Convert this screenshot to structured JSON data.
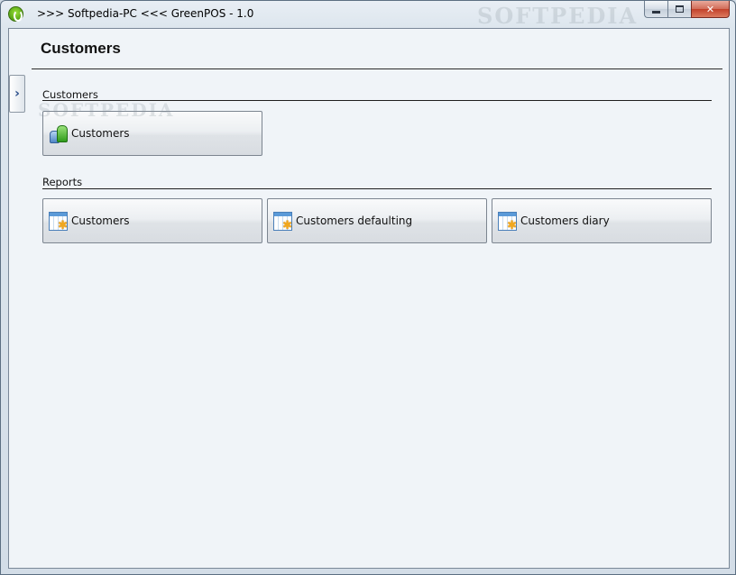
{
  "window": {
    "title": ">>> Softpedia-PC <<< GreenPOS - 1.0",
    "watermark": "SOFTPEDIA"
  },
  "page": {
    "title": "Customers",
    "side_toggle": "›"
  },
  "groups": [
    {
      "label": "Customers",
      "tiles": [
        {
          "label": "Customers",
          "icon": "users-icon"
        }
      ]
    },
    {
      "label": "Reports",
      "tiles": [
        {
          "label": "Customers",
          "icon": "report-icon"
        },
        {
          "label": "Customers defaulting",
          "icon": "report-icon"
        },
        {
          "label": "Customers diary",
          "icon": "report-icon"
        }
      ]
    }
  ],
  "colors": {
    "client_bg": "#f0f4f8",
    "close_button": "#c2412a"
  }
}
